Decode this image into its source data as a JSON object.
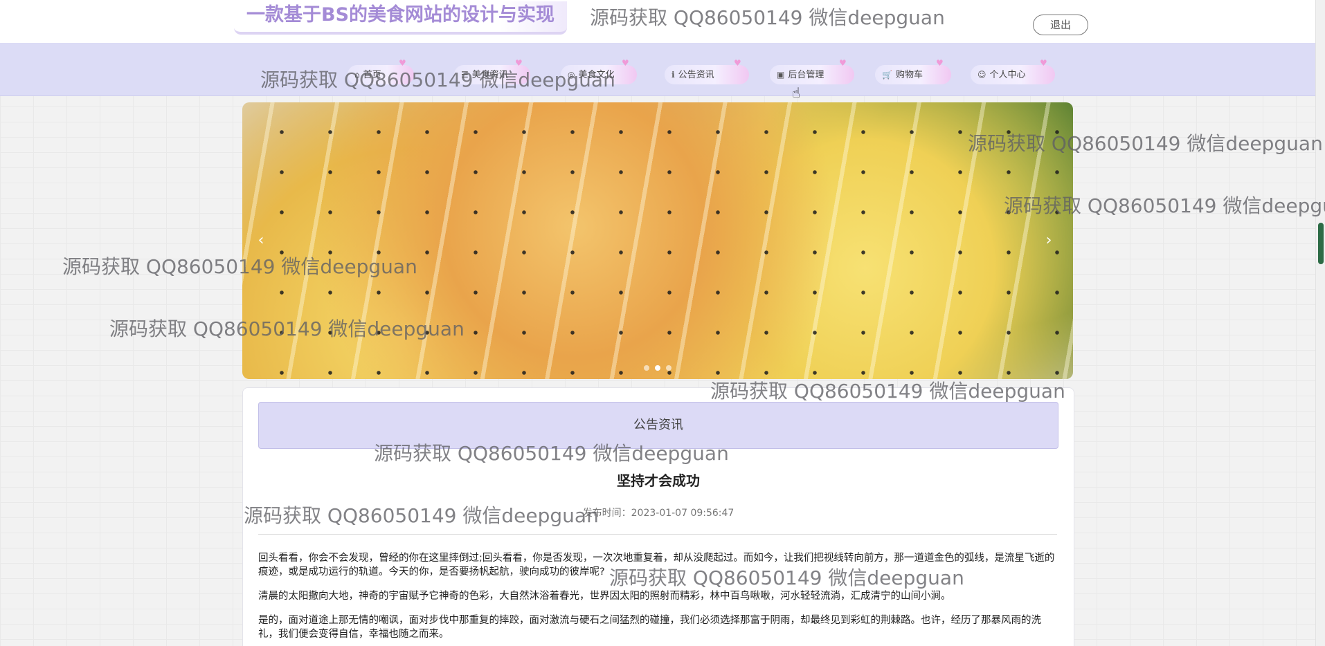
{
  "header": {
    "site_title": "一款基于BS的美食网站的设计与实现",
    "logout_label": "退出"
  },
  "nav": {
    "items": [
      {
        "label": "首页",
        "icon": "home-icon",
        "glyph": "⌂"
      },
      {
        "label": "美食资讯",
        "icon": "food-info-icon",
        "glyph": "☰"
      },
      {
        "label": "美食文化",
        "icon": "culture-icon",
        "glyph": "◎"
      },
      {
        "label": "公告资讯",
        "icon": "info-icon",
        "glyph": "ℹ"
      },
      {
        "label": "后台管理",
        "icon": "admin-icon",
        "glyph": "▣"
      },
      {
        "label": "购物车",
        "icon": "cart-icon",
        "glyph": "🛒"
      },
      {
        "label": "个人中心",
        "icon": "user-icon",
        "glyph": "☺"
      }
    ]
  },
  "banner": {
    "prev_glyph": "‹",
    "next_glyph": "›"
  },
  "section": {
    "title": "公告资讯"
  },
  "article": {
    "title": "坚持才会成功",
    "meta": "发布时间：2023-01-07 09:56:47",
    "paragraphs": [
      "回头看看，你会不会发现，曾经的你在这里摔倒过;回头看看，你是否发现，一次次地重复着，却从没爬起过。而如今，让我们把视线转向前方，那一道道金色的弧线，是流星飞逝的痕迹，或是成功运行的轨道。今天的你，是否要扬帆起航，驶向成功的彼岸呢?",
      "清晨的太阳撒向大地，神奇的宇宙赋予它神奇的色彩，大自然沐浴着春光，世界因太阳的照射而精彩，林中百鸟啾啾，河水轻轻流淌，汇成清宁的山间小涧。",
      "是的，面对道途上那无情的嘲讽，面对步伐中那重复的摔跤，面对激流与硬石之间猛烈的碰撞，我们必须选择那富于阴雨，却最终见到彩虹的荆棘路。也许，经历了那暴风雨的洗礼，我们便会变得自信，幸福也随之而来。"
    ]
  },
  "watermark": {
    "text": "源码获取 QQ86050149 微信deepguan"
  },
  "colors": {
    "accent": "#a48bd6",
    "nav_bg": "#dcdcf6",
    "section_header_bg": "#dcdaf6"
  }
}
